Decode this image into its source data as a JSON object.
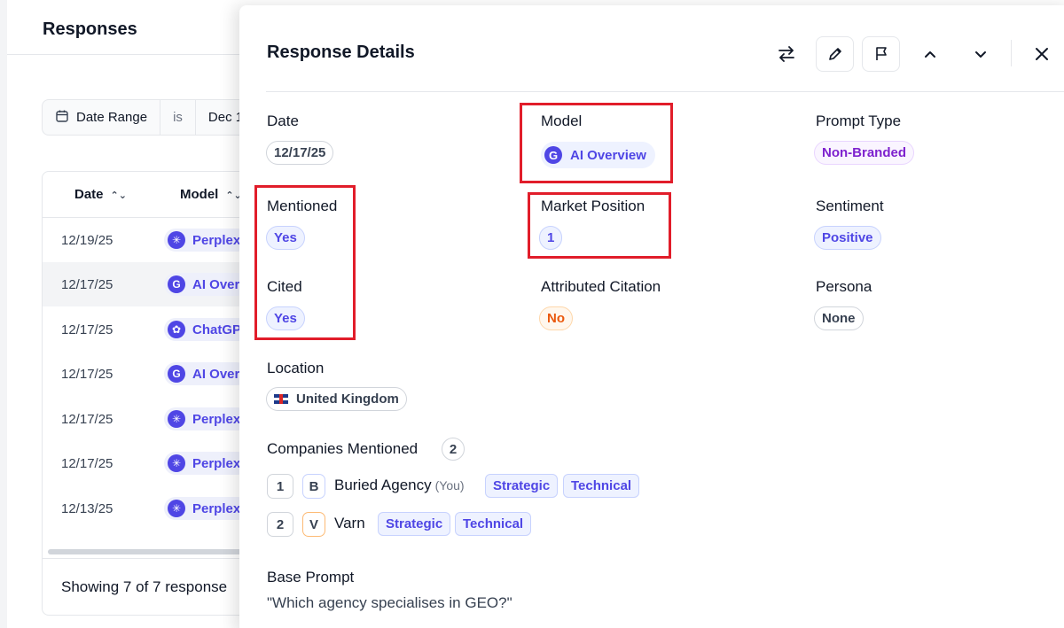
{
  "page": {
    "title": "Responses",
    "filter": {
      "field": "Date Range",
      "operator": "is",
      "value": "Dec 1"
    },
    "table": {
      "columns": [
        "Date",
        "Model"
      ],
      "rows": [
        {
          "date": "12/19/25",
          "model": "Perplex",
          "icon": "perplexity-icon"
        },
        {
          "date": "12/17/25",
          "model": "AI Over",
          "icon": "google-icon"
        },
        {
          "date": "12/17/25",
          "model": "ChatGP",
          "icon": "chatgpt-icon"
        },
        {
          "date": "12/17/25",
          "model": "AI Over",
          "icon": "google-icon"
        },
        {
          "date": "12/17/25",
          "model": "Perplex",
          "icon": "perplexity-icon"
        },
        {
          "date": "12/17/25",
          "model": "Perplex",
          "icon": "perplexity-icon"
        },
        {
          "date": "12/13/25",
          "model": "Perplex",
          "icon": "perplexity-icon"
        }
      ],
      "footer": "Showing 7 of 7 response"
    }
  },
  "drawer": {
    "title": "Response Details",
    "fields": {
      "date": {
        "label": "Date",
        "value": "12/17/25"
      },
      "model": {
        "label": "Model",
        "value": "AI Overview"
      },
      "prompt_type": {
        "label": "Prompt Type",
        "value": "Non-Branded"
      },
      "mentioned": {
        "label": "Mentioned",
        "value": "Yes"
      },
      "market_position": {
        "label": "Market Position",
        "value": "1"
      },
      "sentiment": {
        "label": "Sentiment",
        "value": "Positive"
      },
      "cited": {
        "label": "Cited",
        "value": "Yes"
      },
      "attributed_citation": {
        "label": "Attributed Citation",
        "value": "No"
      },
      "persona": {
        "label": "Persona",
        "value": "None"
      },
      "location": {
        "label": "Location",
        "value": "United Kingdom"
      }
    },
    "companies": {
      "label": "Companies Mentioned",
      "count": "2",
      "items": [
        {
          "rank": "1",
          "initial": "B",
          "name": "Buried Agency",
          "note": "(You)",
          "tags": [
            "Strategic",
            "Technical"
          ]
        },
        {
          "rank": "2",
          "initial": "V",
          "name": "Varn",
          "note": "",
          "tags": [
            "Strategic",
            "Technical"
          ]
        }
      ]
    },
    "base_prompt": {
      "label": "Base Prompt",
      "value": "\"Which agency specialises in GEO?\""
    }
  },
  "colors": {
    "accent": "#4f46e5",
    "highlight": "#e11d2a",
    "orange": "#ea580c",
    "purple": "#7e22ce"
  }
}
